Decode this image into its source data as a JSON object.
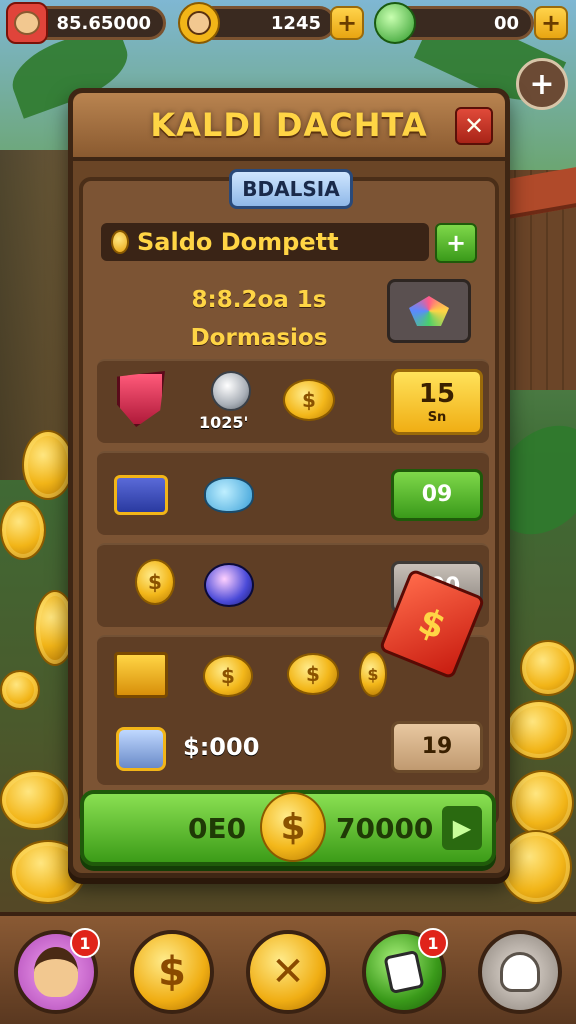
{
  "topbar": {
    "coins_value": "85.65000",
    "level_value": "1245",
    "gems_value": "00",
    "plus": "+",
    "side_plus": "+"
  },
  "panel": {
    "title": "KALDI DACHTA",
    "close": "✕",
    "tab_label": "BDALSIA",
    "saldo_label": "Saldo Dompett",
    "saldo_plus": "+",
    "info_line1": "8:8.2oa 1s",
    "info_line2": "Dormasios"
  },
  "rows": [
    {
      "sub_value": "1025'",
      "price_main": "15",
      "price_sub": "Sn"
    },
    {
      "price_main": "09"
    },
    {
      "price_main": "S00"
    },
    {
      "amount": "$:000",
      "price_main": "19"
    }
  ],
  "icons": {
    "dollar": "$"
  },
  "big_button": {
    "left_text": "0E0",
    "right_text": "70000",
    "arrow": "▶"
  },
  "bottom_nav": {
    "profile_badge": "1",
    "shop_badge": "1",
    "coin_glyph": "$",
    "cross_glyph": "✕"
  },
  "colors": {
    "title_gold": "#ffd545",
    "panel_wood": "#6a4526",
    "accent_green": "#3a9a1a",
    "close_red": "#c82a1c"
  }
}
